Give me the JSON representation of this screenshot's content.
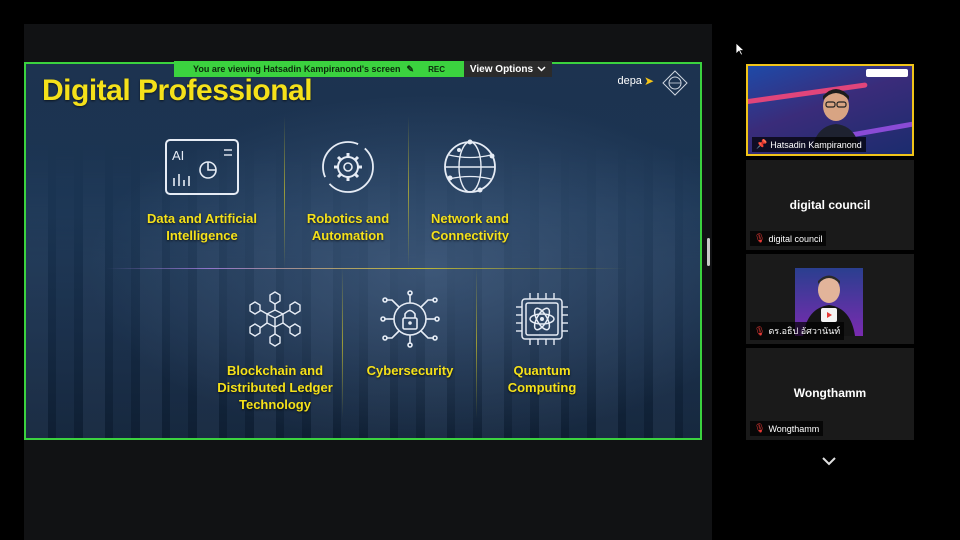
{
  "share_banner": {
    "viewing_text": "You are viewing  Hatsadin Kampiranond's screen",
    "rec_label": "REC",
    "view_options_label": "View Options"
  },
  "slide": {
    "title": "Digital Professional",
    "logo_text": "depa",
    "cards": [
      {
        "label": "Data and Artificial\nIntelligence",
        "icon": "ai-chart-icon"
      },
      {
        "label": "Robotics and\nAutomation",
        "icon": "gear-cycle-icon"
      },
      {
        "label": "Network and\nConnectivity",
        "icon": "network-globe-icon"
      },
      {
        "label": "Blockchain and\nDistributed Ledger\nTechnology",
        "icon": "blockchain-cubes-icon"
      },
      {
        "label": "Cybersecurity",
        "icon": "padlock-circuit-icon"
      },
      {
        "label": "Quantum\nComputing",
        "icon": "atom-chip-icon"
      }
    ]
  },
  "participants": [
    {
      "name": "Hatsadin Kampiranond",
      "center_name": "",
      "mic": "pinned",
      "video": true
    },
    {
      "name": "digital council",
      "center_name": "digital council",
      "mic": "muted",
      "video": false
    },
    {
      "name": "ดร.อธิป อัศวานันท์",
      "center_name": "",
      "mic": "muted",
      "video": true
    },
    {
      "name": "Wongthamm",
      "center_name": "Wongthamm",
      "mic": "muted",
      "video": false
    }
  ],
  "colors": {
    "accent_green": "#3bd23f",
    "title_yellow": "#f5e11a",
    "active_border": "#f0c419",
    "mic_muted": "#e53935"
  }
}
